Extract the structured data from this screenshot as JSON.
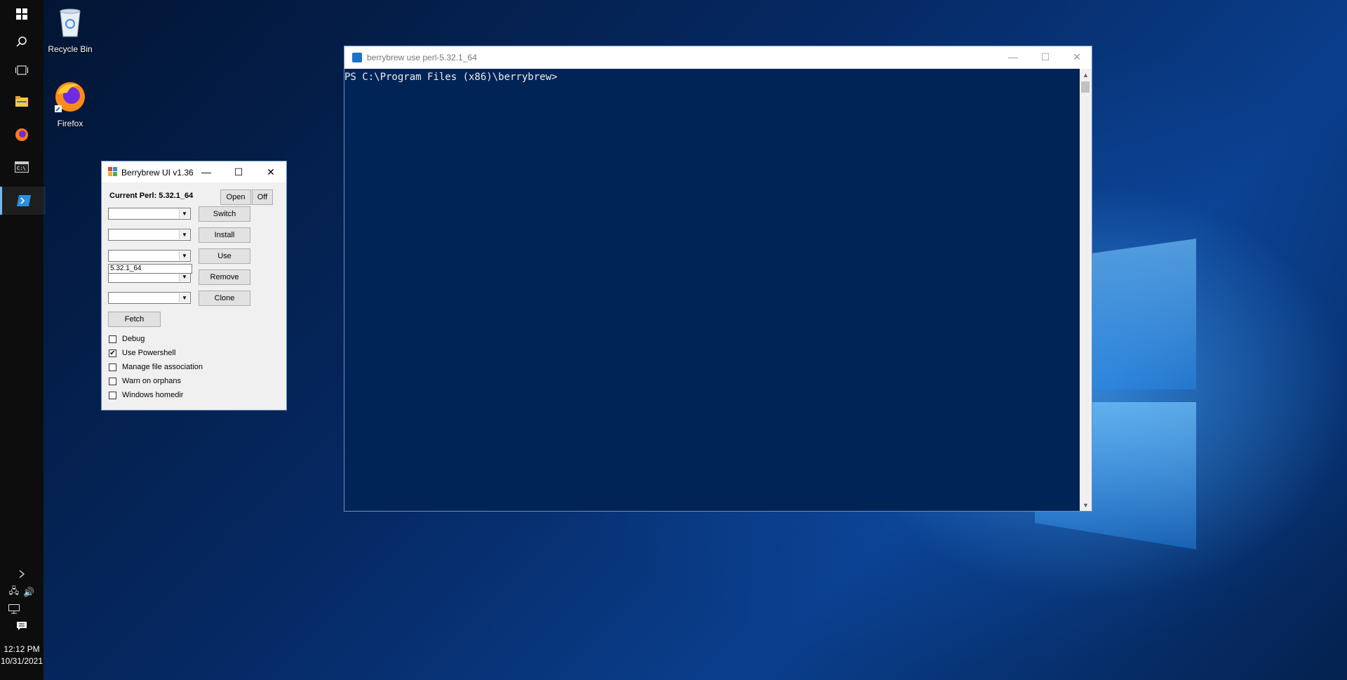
{
  "desktop": {
    "icons": [
      {
        "label": "Recycle Bin"
      },
      {
        "label": "Firefox"
      }
    ]
  },
  "taskbar": {
    "time": "12:12 PM",
    "date": "10/31/2021"
  },
  "berrybrew_window": {
    "title": "Berrybrew UI v1.36",
    "current_perl": "Current Perl: 5.32.1_64",
    "buttons": {
      "open": "Open",
      "off": "Off",
      "switch": "Switch",
      "install": "Install",
      "use": "Use",
      "remove": "Remove",
      "clone": "Clone",
      "fetch": "Fetch"
    },
    "use_combo_text": "5.32.1_64",
    "checkboxes": [
      {
        "label": "Debug",
        "checked": false
      },
      {
        "label": "Use Powershell",
        "checked": true
      },
      {
        "label": "Manage file association",
        "checked": false
      },
      {
        "label": "Warn on orphans",
        "checked": false
      },
      {
        "label": "Windows homedir",
        "checked": false
      }
    ]
  },
  "powershell_window": {
    "title": "berrybrew use perl-5.32.1_64",
    "prompt": "PS C:\\Program Files (x86)\\berrybrew>"
  }
}
